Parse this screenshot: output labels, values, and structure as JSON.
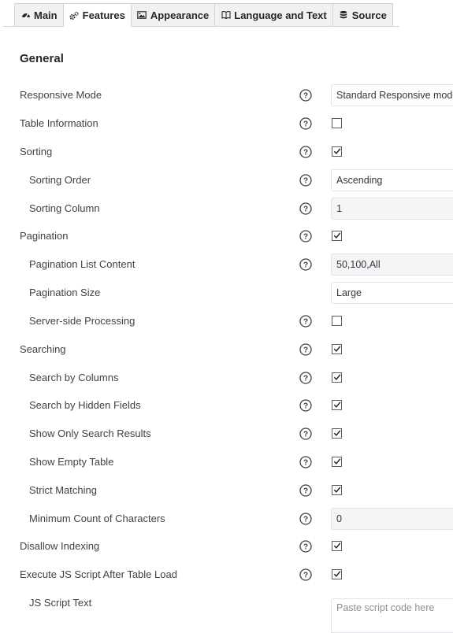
{
  "tabs": [
    {
      "label": "Main",
      "icon": "dashboard-icon",
      "active": false
    },
    {
      "label": "Features",
      "icon": "gears-icon",
      "active": true
    },
    {
      "label": "Appearance",
      "icon": "image-icon",
      "active": false
    },
    {
      "label": "Language and Text",
      "icon": "book-icon",
      "active": false
    },
    {
      "label": "Source",
      "icon": "database-icon",
      "active": false
    }
  ],
  "section": {
    "title": "General"
  },
  "settings": {
    "responsive_mode": {
      "label": "Responsive Mode",
      "value": "Standard Responsive mode"
    },
    "table_information": {
      "label": "Table Information",
      "checked": false
    },
    "sorting": {
      "label": "Sorting",
      "checked": true
    },
    "sorting_order": {
      "label": "Sorting Order",
      "value": "Ascending"
    },
    "sorting_column": {
      "label": "Sorting Column",
      "value": "1"
    },
    "pagination": {
      "label": "Pagination",
      "checked": true
    },
    "pagination_list_content": {
      "label": "Pagination List Content",
      "value": "50,100,All"
    },
    "pagination_size": {
      "label": "Pagination Size",
      "value": "Large"
    },
    "server_side_processing": {
      "label": "Server-side Processing",
      "checked": false
    },
    "searching": {
      "label": "Searching",
      "checked": true
    },
    "search_by_columns": {
      "label": "Search by Columns",
      "checked": true
    },
    "search_by_hidden_fields": {
      "label": "Search by Hidden Fields",
      "checked": true
    },
    "show_only_search_results": {
      "label": "Show Only Search Results",
      "checked": true
    },
    "show_empty_table": {
      "label": "Show Empty Table",
      "checked": true
    },
    "strict_matching": {
      "label": "Strict Matching",
      "checked": true
    },
    "minimum_count_of_characters": {
      "label": "Minimum Count of Characters",
      "value": "0"
    },
    "disallow_indexing": {
      "label": "Disallow Indexing",
      "checked": true
    },
    "execute_js_after_load": {
      "label": "Execute JS Script After Table Load",
      "checked": true
    },
    "js_script_text": {
      "label": "JS Script Text",
      "placeholder": "Paste script code here"
    }
  }
}
